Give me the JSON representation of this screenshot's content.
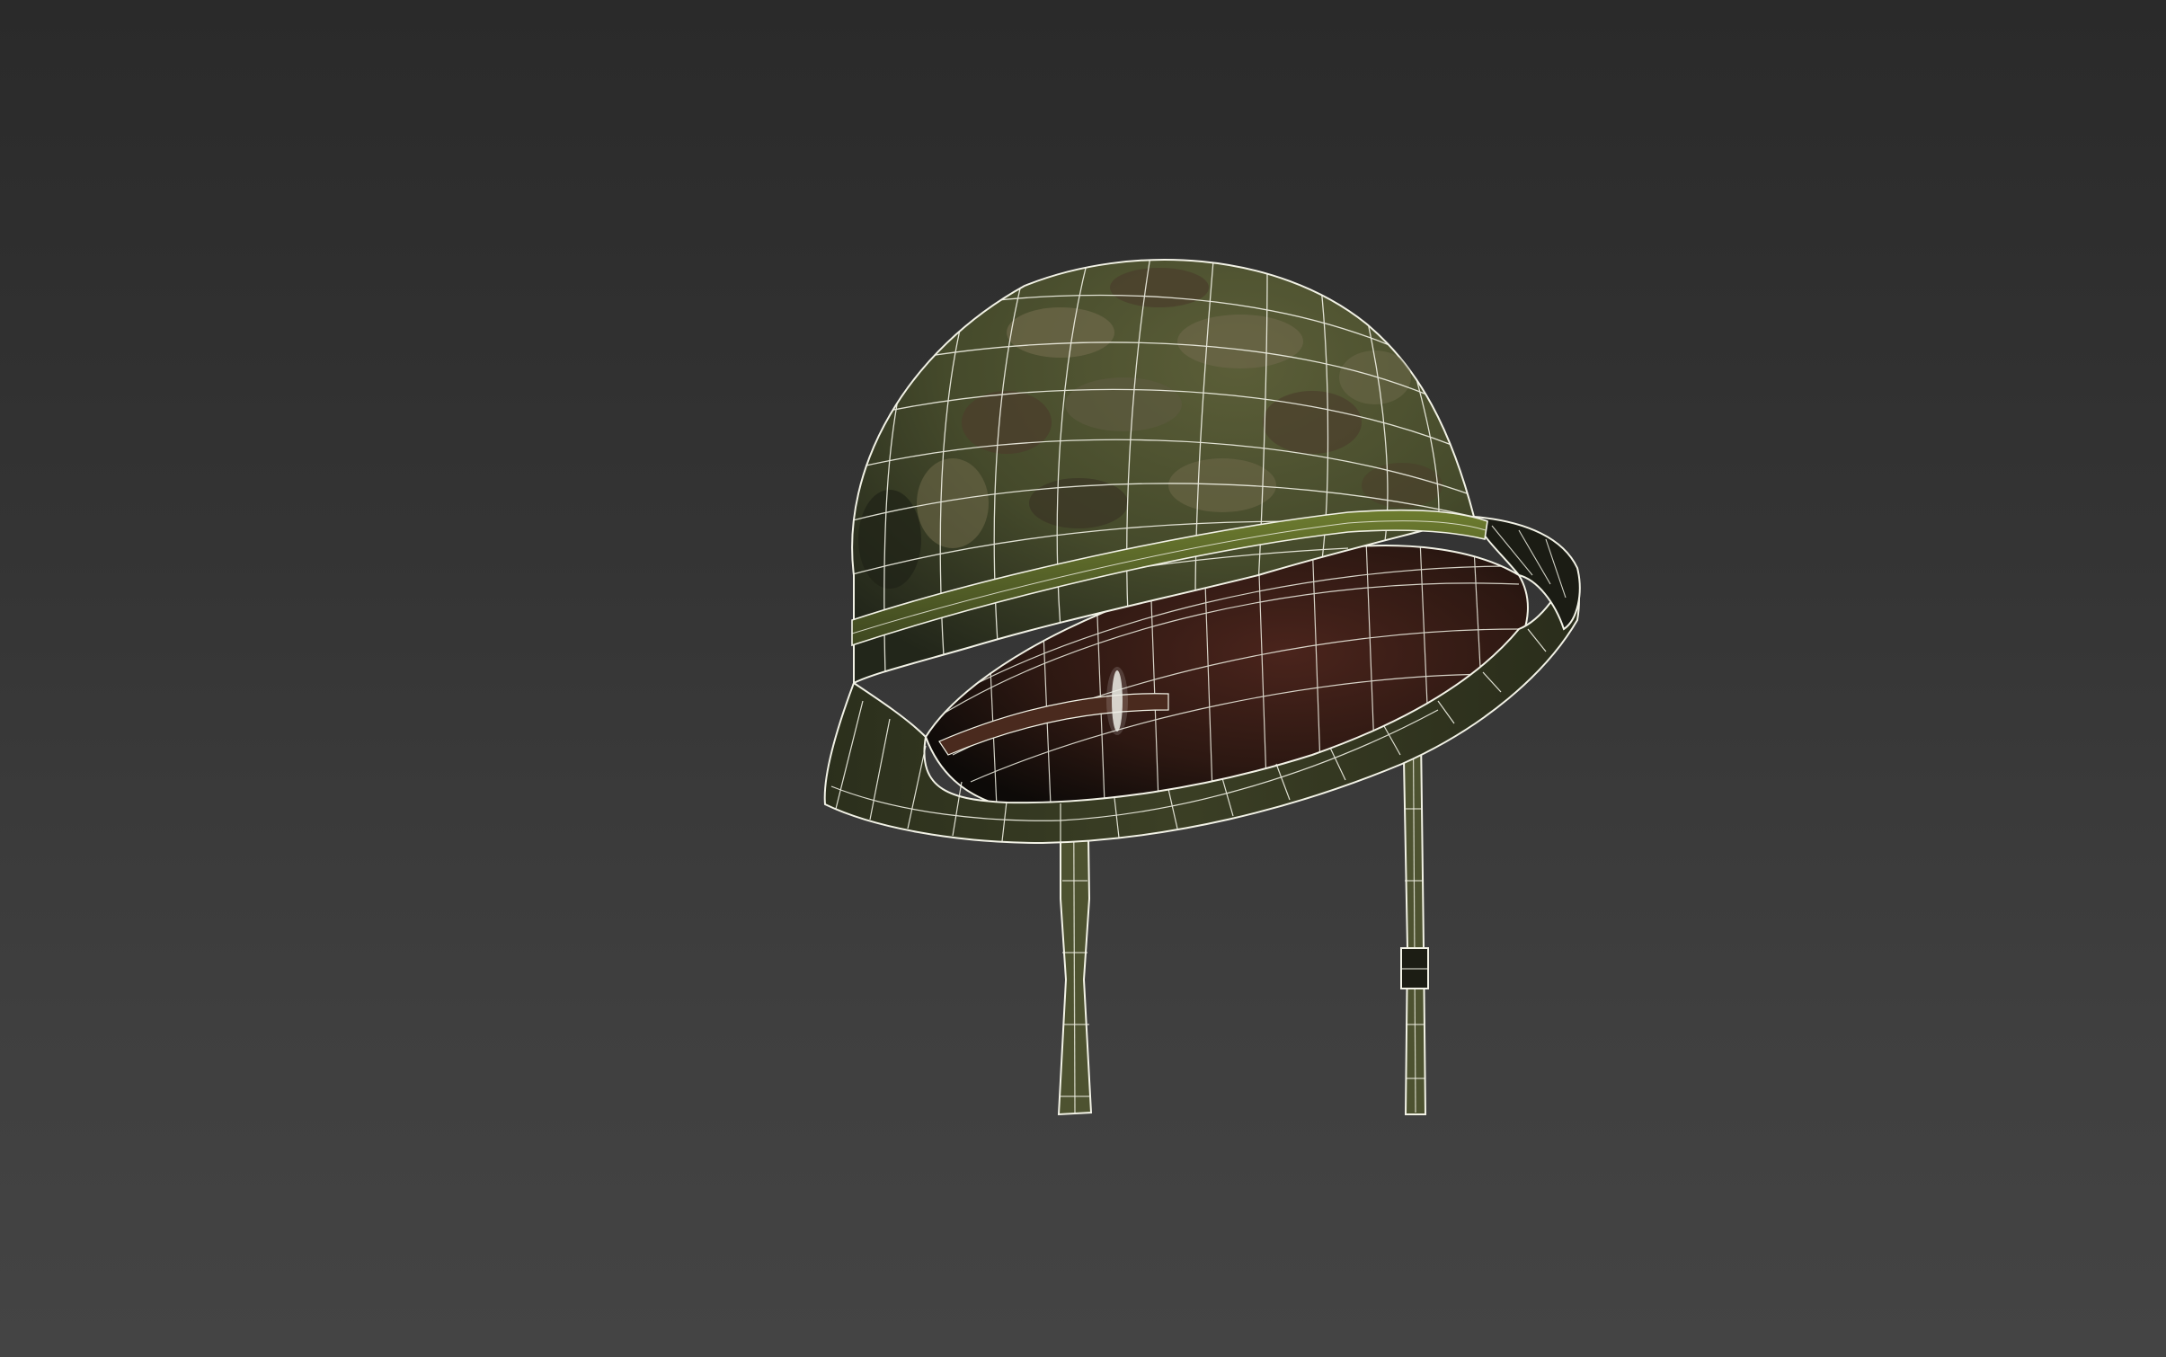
{
  "viewport": {
    "background_top": "#2a2a2a",
    "background_bottom": "#444444",
    "shading_mode": "textured-with-wireframe"
  },
  "model": {
    "object": "military-helmet",
    "material": "woodland-camouflage",
    "colors": {
      "shell_base": "#4a4e2e",
      "shell_dark": "#2f3320",
      "camo_patch_light": "#6c6748",
      "camo_patch_brown": "#4b3f2c",
      "rim_band": "#556128",
      "liner_interior": "#3a1e18",
      "wireframe": "#f2f2e6",
      "strap": "#4d5230"
    },
    "parts": [
      "shell",
      "brim",
      "rim-band",
      "liner",
      "left-chin-strap",
      "right-chin-strap",
      "strap-buckle"
    ]
  }
}
